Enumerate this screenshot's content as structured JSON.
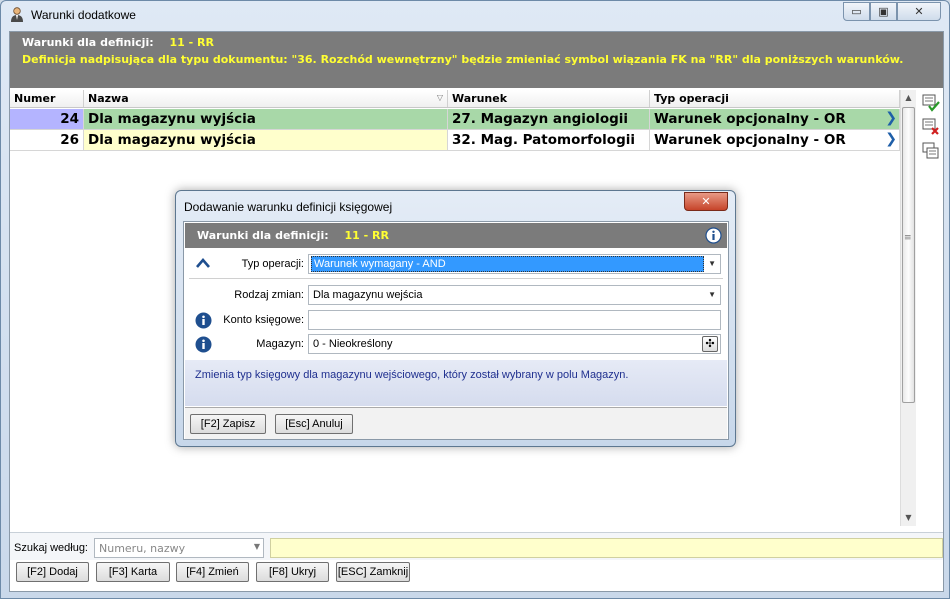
{
  "window": {
    "title": "Warunki dodatkowe",
    "buttons": {
      "minimize": "▭",
      "maximize": "▣",
      "close": "✕"
    }
  },
  "info": {
    "label": "Warunki dla definicji:",
    "value": "11 - RR",
    "message": "Definicja nadpisująca dla typu dokumentu: \"36. Rozchód wewnętrzny\" będzie zmieniać symbol wiązania FK na \"RR\" dla poniższych warunków."
  },
  "grid": {
    "columns": [
      "Numer",
      "Nazwa",
      "Warunek",
      "Typ operacji"
    ],
    "rows": [
      {
        "numer": "24",
        "nazwa": "Dla magazynu wyjścia",
        "warunek": "27. Magazyn angiologii",
        "typ": "Warunek opcjonalny - OR"
      },
      {
        "numer": "26",
        "nazwa": "Dla magazynu wyjścia",
        "warunek": "32. Mag. Patomorfologii",
        "typ": "Warunek opcjonalny - OR"
      }
    ]
  },
  "search": {
    "label": "Szukaj według:",
    "combo_placeholder": "Numeru, nazwy",
    "value": ""
  },
  "buttons": {
    "add": "[F2] Dodaj",
    "card": "[F3] Karta",
    "change": "[F4] Zmień",
    "hide": "[F8] Ukryj",
    "close": "[ESC] Zamknij"
  },
  "dialog": {
    "title": "Dodawanie warunku definicji księgowej",
    "close_label": "✕",
    "header_label": "Warunki dla definicji:",
    "header_value": "11 - RR",
    "fields": {
      "typ_label": "Typ operacji:",
      "typ_value": "Warunek wymagany - AND",
      "rodzaj_label": "Rodzaj zmian:",
      "rodzaj_value": "Dla magazynu wejścia",
      "konto_label": "Konto księgowe:",
      "konto_value": "",
      "magazyn_label": "Magazyn:",
      "magazyn_value": "0 - Nieokreślony"
    },
    "hint": "Zmienia typ księgowy dla magazynu wejściowego, który został wybrany w polu Magazyn.",
    "save": "[F2] Zapisz",
    "cancel": "[Esc] Anuluj"
  },
  "colors": {
    "info_band": "#7b7b7b",
    "yellow_text": "#ffff33",
    "row_selected": "#a8d8a8",
    "row_number_selected": "#b4b4ff",
    "row_highlight": "#ffffcc",
    "accent_blue": "#1f5fa8"
  }
}
